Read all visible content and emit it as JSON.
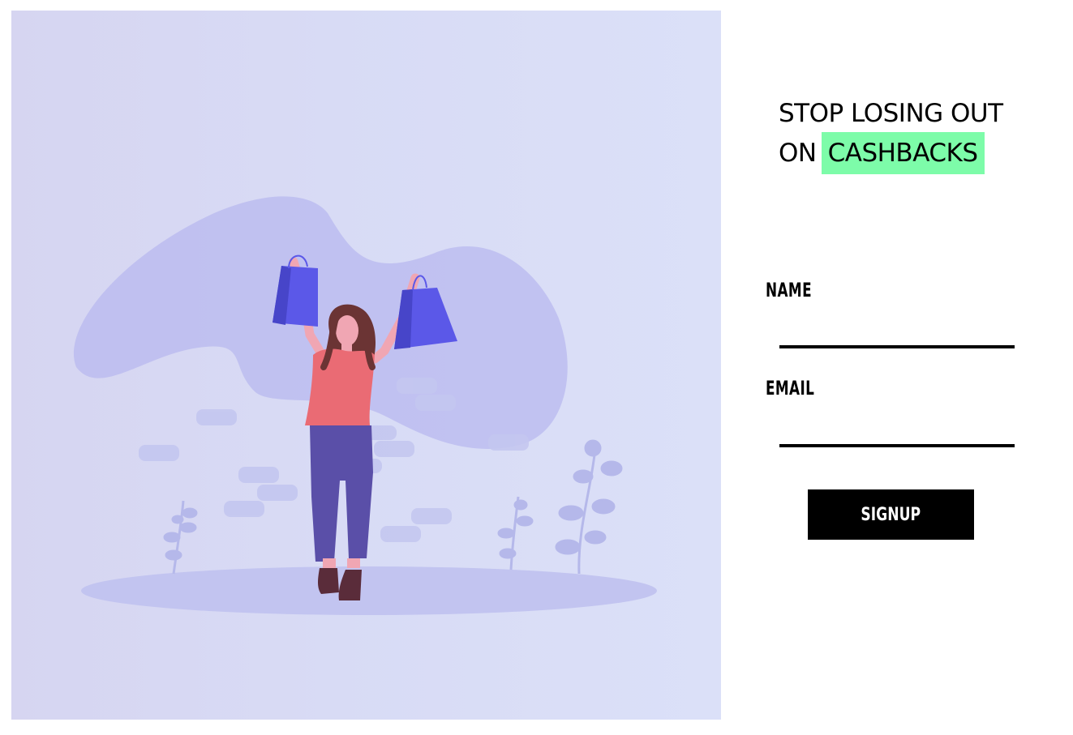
{
  "headline": {
    "line1": "STOP LOSING OUT",
    "line2_prefix": "ON",
    "line2_highlight": "CASHBACKS"
  },
  "form": {
    "name_label": "NAME",
    "name_value": "",
    "email_label": "EMAIL",
    "email_value": "",
    "submit_label": "SIGNUP"
  },
  "colors": {
    "highlight": "#7dfca9",
    "button": "#000000",
    "button_text": "#ffffff",
    "illustration_accent": "#6c63ff"
  },
  "illustration": {
    "icon": "woman-with-shopping-bags-illustration"
  }
}
